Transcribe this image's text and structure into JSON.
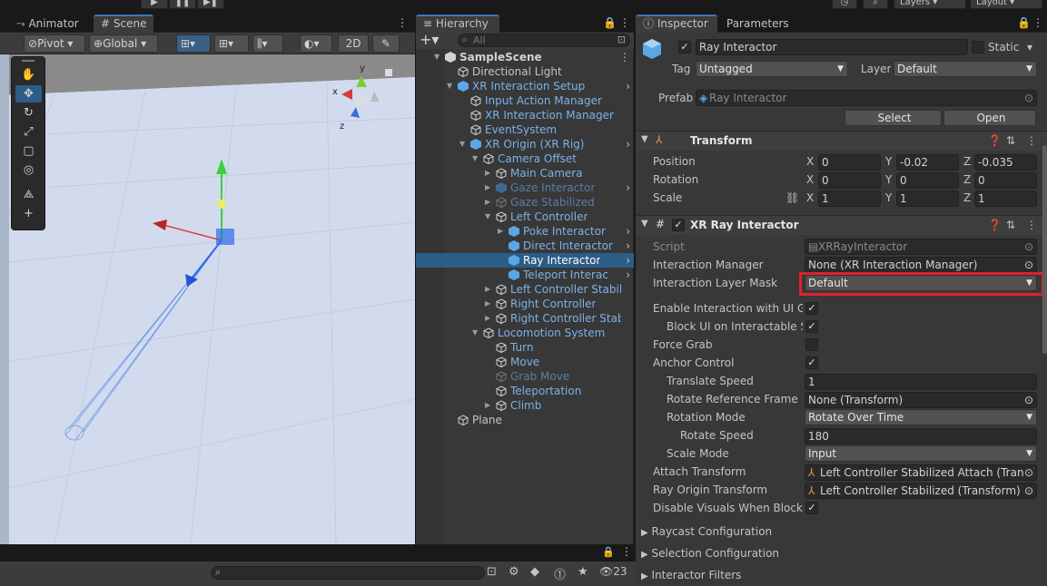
{
  "top": {
    "play": "▶",
    "pause": "❚❚",
    "step": "▶❚",
    "layers": "Layers",
    "layout": "Layout"
  },
  "tabs": {
    "animator": "Animator",
    "scene": "Scene",
    "hierarchy": "Hierarchy",
    "inspector": "Inspector",
    "parameters": "Parameters"
  },
  "scene_toolbar": {
    "pivot": "Pivot",
    "global": "Global",
    "mode_2d": "2D"
  },
  "gizmo": {
    "x": "x",
    "y": "y",
    "z": "z"
  },
  "hierarchy": {
    "search_placeholder": "All",
    "rows": [
      {
        "label": "SampleScene",
        "indent": 0,
        "bold": true,
        "arrow": "▼",
        "icon": "unity",
        "color": "#d2d2d2"
      },
      {
        "label": "Directional Light",
        "indent": 1,
        "arrow": "",
        "icon": "cube-outline",
        "color": "#c4c4c4"
      },
      {
        "label": "XR Interaction Setup",
        "indent": 1,
        "arrow": "▼",
        "icon": "prefab",
        "color": "#7bb2e8",
        "chev": true
      },
      {
        "label": "Input Action Manager",
        "indent": 2,
        "arrow": "",
        "icon": "cube-outline",
        "color": "#7bb2e8"
      },
      {
        "label": "XR Interaction Manager",
        "indent": 2,
        "arrow": "",
        "icon": "cube-outline",
        "color": "#7bb2e8"
      },
      {
        "label": "EventSystem",
        "indent": 2,
        "arrow": "",
        "icon": "cube-outline",
        "color": "#7bb2e8"
      },
      {
        "label": "XR Origin (XR Rig)",
        "indent": 2,
        "arrow": "▼",
        "icon": "prefab",
        "color": "#7bb2e8",
        "chev": true
      },
      {
        "label": "Camera Offset",
        "indent": 3,
        "arrow": "▼",
        "icon": "cube-outline",
        "color": "#7bb2e8"
      },
      {
        "label": "Main Camera",
        "indent": 4,
        "arrow": "▶",
        "icon": "cube-outline",
        "color": "#7bb2e8"
      },
      {
        "label": "Gaze Interactor",
        "indent": 4,
        "arrow": "▶",
        "icon": "prefab-dim",
        "color": "#5a7ea3",
        "chev": true
      },
      {
        "label": "Gaze Stabilized",
        "indent": 4,
        "arrow": "▶",
        "icon": "cube-dim",
        "color": "#5a7ea3"
      },
      {
        "label": "Left Controller",
        "indent": 4,
        "arrow": "▼",
        "icon": "cube-outline",
        "color": "#7bb2e8"
      },
      {
        "label": "Poke Interactor",
        "indent": 5,
        "arrow": "▶",
        "icon": "prefab",
        "color": "#7bb2e8",
        "chev": true
      },
      {
        "label": "Direct Interactor",
        "indent": 5,
        "arrow": "",
        "icon": "prefab",
        "color": "#7bb2e8",
        "chev": true
      },
      {
        "label": "Ray Interactor",
        "indent": 5,
        "arrow": "",
        "icon": "prefab",
        "color": "#ffffff",
        "chev": true,
        "selected": true
      },
      {
        "label": "Teleport Interac",
        "indent": 5,
        "arrow": "",
        "icon": "prefab",
        "color": "#7bb2e8",
        "chev": true
      },
      {
        "label": "Left Controller Stabiliz",
        "indent": 4,
        "arrow": "▶",
        "icon": "cube-outline",
        "color": "#7bb2e8"
      },
      {
        "label": "Right Controller",
        "indent": 4,
        "arrow": "▶",
        "icon": "cube-outline",
        "color": "#7bb2e8"
      },
      {
        "label": "Right Controller Stabi",
        "indent": 4,
        "arrow": "▶",
        "icon": "cube-outline",
        "color": "#7bb2e8"
      },
      {
        "label": "Locomotion System",
        "indent": 3,
        "arrow": "▼",
        "icon": "cube-outline",
        "color": "#7bb2e8"
      },
      {
        "label": "Turn",
        "indent": 4,
        "arrow": "",
        "icon": "cube-outline",
        "color": "#7bb2e8"
      },
      {
        "label": "Move",
        "indent": 4,
        "arrow": "",
        "icon": "cube-outline",
        "color": "#7bb2e8"
      },
      {
        "label": "Grab Move",
        "indent": 4,
        "arrow": "",
        "icon": "cube-dim",
        "color": "#5a7ea3"
      },
      {
        "label": "Teleportation",
        "indent": 4,
        "arrow": "",
        "icon": "cube-outline",
        "color": "#7bb2e8"
      },
      {
        "label": "Climb",
        "indent": 4,
        "arrow": "▶",
        "icon": "cube-outline",
        "color": "#7bb2e8"
      },
      {
        "label": "Plane",
        "indent": 1,
        "arrow": "",
        "icon": "cube-outline",
        "color": "#c4c4c4"
      }
    ]
  },
  "inspector": {
    "object_name": "Ray Interactor",
    "static_label": "Static",
    "tag_label": "Tag",
    "tag_value": "Untagged",
    "layer_label": "Layer",
    "layer_value": "Default",
    "prefab_label": "Prefab",
    "prefab_value": "Ray Interactor",
    "select_label": "Select",
    "open_label": "Open",
    "transform": {
      "title": "Transform",
      "rows": [
        {
          "label": "Position",
          "x": "0",
          "y": "-0.02",
          "z": "-0.035"
        },
        {
          "label": "Rotation",
          "x": "0",
          "y": "0",
          "z": "0"
        },
        {
          "label": "Scale",
          "x": "1",
          "y": "1",
          "z": "1"
        }
      ]
    },
    "ray": {
      "title": "XR Ray Interactor",
      "script_label": "Script",
      "script_value": "XRRayInteractor",
      "im_label": "Interaction Manager",
      "im_value": "None (XR Interaction Manager)",
      "ilm_label": "Interaction Layer Mask",
      "ilm_value": "Default",
      "eui_label": "Enable Interaction with UI Gar",
      "bui_label": "Block UI on Interactable Se",
      "fg_label": "Force Grab",
      "ac_label": "Anchor Control",
      "ts_label": "Translate Speed",
      "ts_value": "1",
      "rrf_label": "Rotate Reference Frame",
      "rrf_value": "None (Transform)",
      "rm_label": "Rotation Mode",
      "rm_value": "Rotate Over Time",
      "rs_label": "Rotate Speed",
      "rs_value": "180",
      "sm_label": "Scale Mode",
      "sm_value": "Input",
      "at_label": "Attach Transform",
      "at_value": "Left Controller Stabilized Attach (Transf",
      "rot_label": "Ray Origin Transform",
      "rot_value": "Left Controller Stabilized (Transform)",
      "dv_label": "Disable Visuals When Blockec"
    },
    "foldouts": [
      "Raycast Configuration",
      "Selection Configuration",
      "Interactor Filters"
    ]
  },
  "bottom": {
    "count": "23"
  },
  "colors": {
    "accent": "#3a79bb",
    "selection": "#2c5d87",
    "highlight_box": "#e3202a"
  }
}
